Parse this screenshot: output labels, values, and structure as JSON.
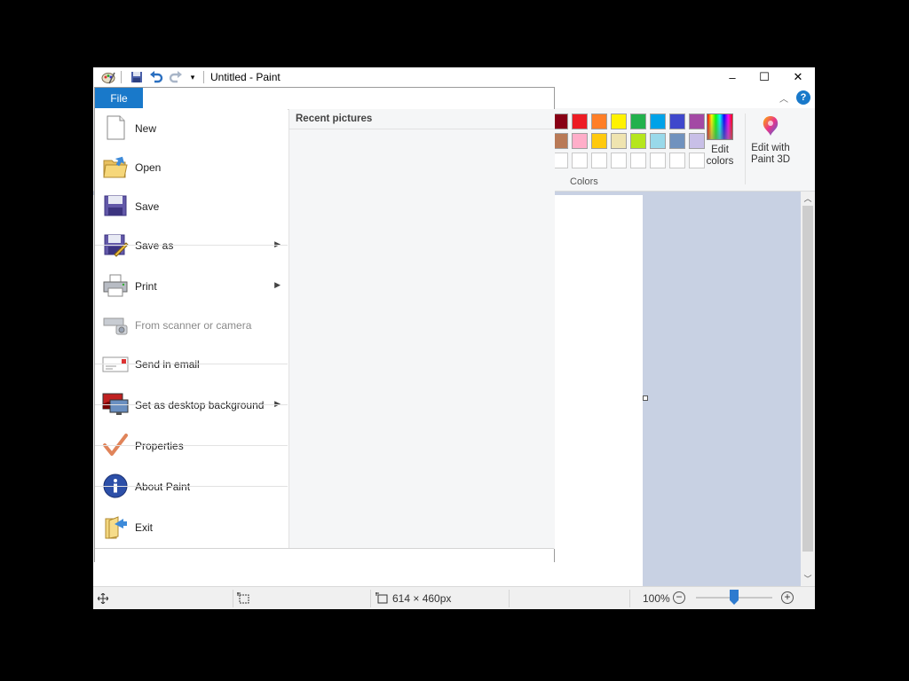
{
  "window": {
    "title": "Untitled - Paint",
    "controls": {
      "minimize": "–",
      "maximize": "☐",
      "close": "✕"
    }
  },
  "file_tab": {
    "label": "File"
  },
  "file_menu": {
    "items": [
      {
        "label": "New",
        "icon": "new-document-icon",
        "has_submenu": false,
        "enabled": true
      },
      {
        "label": "Open",
        "icon": "open-folder-icon",
        "has_submenu": false,
        "enabled": true
      },
      {
        "label": "Save",
        "icon": "save-floppy-icon",
        "has_submenu": false,
        "enabled": true
      },
      {
        "label": "Save as",
        "icon": "save-as-icon",
        "has_submenu": true,
        "enabled": true
      },
      {
        "label": "Print",
        "icon": "printer-icon",
        "has_submenu": true,
        "enabled": true
      },
      {
        "label": "From scanner or camera",
        "icon": "scanner-icon",
        "has_submenu": false,
        "enabled": false
      },
      {
        "label": "Send in email",
        "icon": "email-icon",
        "has_submenu": false,
        "enabled": true
      },
      {
        "label": "Set as desktop background",
        "icon": "desktop-background-icon",
        "has_submenu": true,
        "enabled": true
      },
      {
        "label": "Properties",
        "icon": "checkmark-icon",
        "has_submenu": false,
        "enabled": true
      },
      {
        "label": "About Paint",
        "icon": "info-icon",
        "has_submenu": false,
        "enabled": true
      },
      {
        "label": "Exit",
        "icon": "exit-icon",
        "has_submenu": false,
        "enabled": true
      }
    ],
    "recent_header": "Recent pictures"
  },
  "ribbon": {
    "colors_group_label": "Colors",
    "palette_row1": [
      "#880015",
      "#ed1c24",
      "#ff7f27",
      "#fff200",
      "#22b14c",
      "#00a2e8",
      "#3f48cc",
      "#a349a4"
    ],
    "palette_row2": [
      "#b97a57",
      "#ffaec9",
      "#ffc90e",
      "#efe4b0",
      "#b5e61d",
      "#99d9ea",
      "#7092be",
      "#c8bfe7"
    ],
    "edit_colors_label_1": "Edit",
    "edit_colors_label_2": "colors",
    "paint3d_label_1": "Edit with",
    "paint3d_label_2": "Paint 3D"
  },
  "statusbar": {
    "dimensions": "614 × 460px",
    "zoom": "100%",
    "zoom_fraction": 0.5
  },
  "colors": {
    "file_tab": "#1979ca",
    "canvas_background": "#c8d1e3",
    "help": "#1979ca"
  }
}
